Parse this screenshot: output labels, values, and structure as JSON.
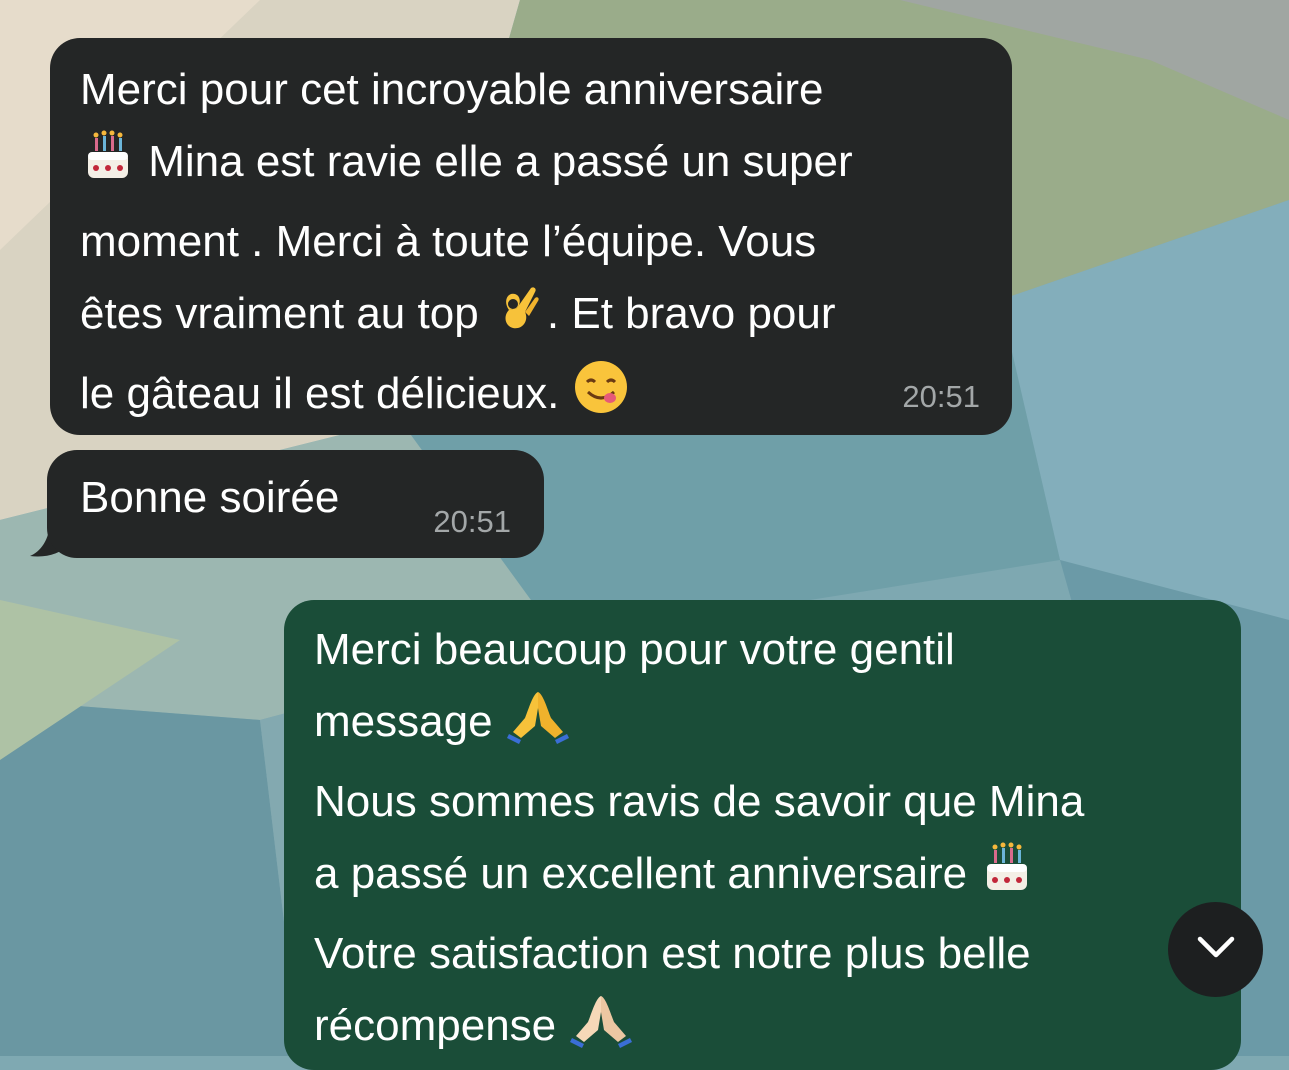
{
  "messages": [
    {
      "direction": "incoming",
      "lines": [
        "Merci pour cet incroyable anniversaire",
        "Mina est ravie elle a passé un super",
        "moment . Merci à toute l’équipe. Vous",
        "êtes vraiment au top",
        ". Et bravo pour",
        "le gâteau il est délicieux."
      ],
      "emojis": [
        "cake-emoji",
        "ok-hand-emoji",
        "yum-face-emoji"
      ],
      "time": "20:51"
    },
    {
      "direction": "incoming",
      "text": "Bonne soirée",
      "time": "20:51"
    },
    {
      "direction": "outgoing",
      "lines": [
        "Merci beaucoup pour votre gentil",
        "message",
        "Nous sommes ravis de savoir que Mina",
        "a passé un excellent anniversaire",
        "Votre satisfaction est notre plus belle",
        "récompense"
      ],
      "emojis": [
        "folded-hands-emoji",
        "cake-emoji",
        "folded-hands-emoji"
      ]
    }
  ],
  "scroll_button": {
    "icon": "chevron-down-icon"
  },
  "colors": {
    "incoming_bubble": "#242626",
    "outgoing_bubble": "#1a4d38",
    "timestamp": "#a3a7a8",
    "scroll_button": "#1d1f20"
  }
}
